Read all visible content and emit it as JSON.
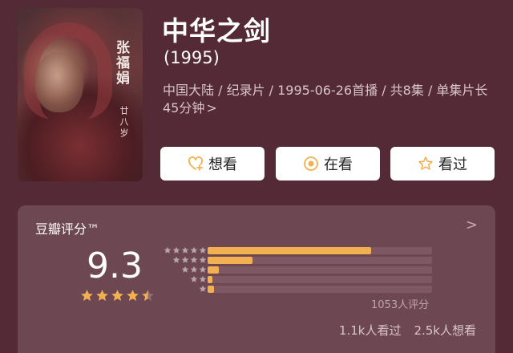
{
  "poster": {
    "title": "张福娟",
    "subtitle": "廿八岁"
  },
  "movie": {
    "title": "中华之剑",
    "year": "(1995)",
    "meta": "中国大陆 / 纪录片 / 1995-06-26首播 / 共8集 / 单集片长45分钟",
    "meta_chevron": ">"
  },
  "actions": {
    "want": "想看",
    "doing": "在看",
    "done": "看过"
  },
  "rating": {
    "label": "豆瓣评分™",
    "chevron": ">",
    "score": "9.3",
    "score_stars": 4.5,
    "distribution": [
      {
        "stars": 5,
        "fraction": 0.73
      },
      {
        "stars": 4,
        "fraction": 0.2
      },
      {
        "stars": 3,
        "fraction": 0.05
      },
      {
        "stars": 2,
        "fraction": 0.01
      },
      {
        "stars": 1,
        "fraction": 0.03
      }
    ],
    "count": "1053人评分",
    "watched": "1.1k人看过",
    "wanted": "2.5k人想看"
  },
  "colors": {
    "background": "#532a35",
    "card": "#6d4752",
    "star": "#f2b050",
    "star_small": "#b7a5aa"
  },
  "icons": {
    "want": "heart-plus-icon",
    "doing": "target-circle-icon",
    "done": "star-outline-icon"
  }
}
